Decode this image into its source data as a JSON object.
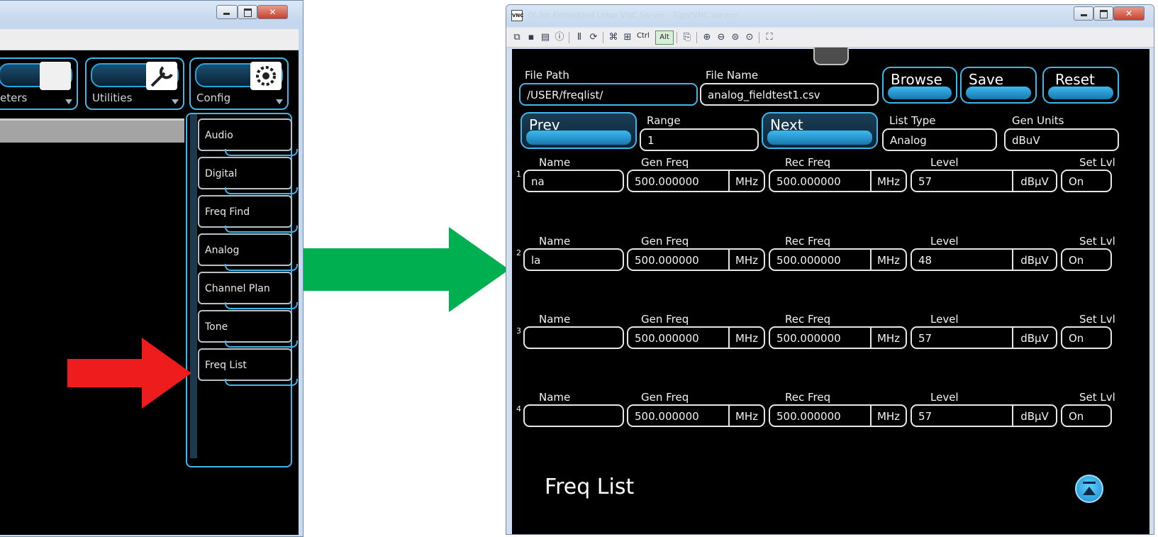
{
  "left": {
    "top_buttons": [
      {
        "label": "eters",
        "icon": "meters-icon"
      },
      {
        "label": "Utilities",
        "icon": "wrench-icon"
      },
      {
        "label": "Config",
        "icon": "gear-icon"
      }
    ],
    "menu_items": [
      "Audio",
      "Digital",
      "Freq Find",
      "Analog",
      "Channel Plan",
      "Tone",
      "Freq List"
    ],
    "colors": {
      "accent": "#3fb7ea",
      "pointer_arrow": "#ee1c1c",
      "transition_arrow": "#00b050"
    }
  },
  "window": {
    "title": "Qt for Embedded Linux VNC Server - TightVNC Viewer",
    "toolbar_ctrl": "Ctrl",
    "toolbar_alt": "Alt"
  },
  "form": {
    "file_path_label": "File Path",
    "file_path_value": "/USER/freqlist/",
    "file_name_label": "File Name",
    "file_name_value": "analog_fieldtest1.csv",
    "browse": "Browse",
    "save": "Save",
    "reset": "Reset",
    "prev": "Prev",
    "next": "Next",
    "range_label": "Range",
    "range_value": "1",
    "list_type_label": "List Type",
    "list_type_value": "Analog",
    "gen_units_label": "Gen Units",
    "gen_units_value": "dBuV"
  },
  "row_headers": {
    "name": "Name",
    "gen_freq": "Gen Freq",
    "rec_freq": "Rec Freq",
    "level": "Level",
    "set_lvl": "Set Lvl"
  },
  "rows": [
    {
      "index": "1",
      "name": "na",
      "gen_freq": "500.000000",
      "gen_unit": "MHz",
      "rec_freq": "500.000000",
      "rec_unit": "MHz",
      "level": "57",
      "level_unit": "dBμV",
      "set_lvl": "On"
    },
    {
      "index": "2",
      "name": "la",
      "gen_freq": "500.000000",
      "gen_unit": "MHz",
      "rec_freq": "500.000000",
      "rec_unit": "MHz",
      "level": "48",
      "level_unit": "dBμV",
      "set_lvl": "On"
    },
    {
      "index": "3",
      "name": "",
      "gen_freq": "500.000000",
      "gen_unit": "MHz",
      "rec_freq": "500.000000",
      "rec_unit": "MHz",
      "level": "57",
      "level_unit": "dBμV",
      "set_lvl": "On"
    },
    {
      "index": "4",
      "name": "",
      "gen_freq": "500.000000",
      "gen_unit": "MHz",
      "rec_freq": "500.000000",
      "rec_unit": "MHz",
      "level": "57",
      "level_unit": "dBμV",
      "set_lvl": "On"
    }
  ],
  "page_title": "Freq List"
}
